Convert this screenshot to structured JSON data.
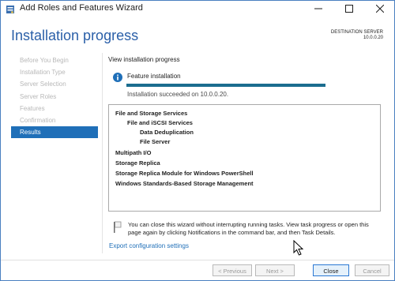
{
  "window": {
    "title": "Add Roles and Features Wizard",
    "icon": "server-manager-icon",
    "controls": [
      "minimize-icon",
      "maximize-icon",
      "close-icon"
    ]
  },
  "header": {
    "page_title": "Installation progress",
    "destination_label": "DESTINATION SERVER",
    "destination_value": "10.0.0.20"
  },
  "nav": {
    "items": [
      {
        "label": "Before You Begin",
        "active": false
      },
      {
        "label": "Installation Type",
        "active": false
      },
      {
        "label": "Server Selection",
        "active": false
      },
      {
        "label": "Server Roles",
        "active": false
      },
      {
        "label": "Features",
        "active": false
      },
      {
        "label": "Confirmation",
        "active": false
      },
      {
        "label": "Results",
        "active": true
      }
    ]
  },
  "main": {
    "view_label": "View installation progress",
    "feature_label": "Feature installation",
    "progress_fraction": 1.0,
    "success_text": "Installation succeeded on 10.0.0.20.",
    "results": [
      {
        "text": "File and Storage Services",
        "level": 0
      },
      {
        "text": "File and iSCSI Services",
        "level": 1
      },
      {
        "text": "Data Deduplication",
        "level": 2
      },
      {
        "text": "File Server",
        "level": 2
      },
      {
        "text": "Multipath I/O",
        "level": 0
      },
      {
        "text": "Storage Replica",
        "level": 0
      },
      {
        "text": "Storage Replica Module for Windows PowerShell",
        "level": 0
      },
      {
        "text": "Windows Standards-Based Storage Management",
        "level": 0
      }
    ],
    "note_text": "You can close this wizard without interrupting running tasks. View task progress or open this page again by clicking Notifications in the command bar, and then Task Details.",
    "export_link": "Export configuration settings"
  },
  "footer": {
    "previous_label": "< Previous",
    "next_label": "Next >",
    "close_label": "Close",
    "cancel_label": "Cancel"
  },
  "colors": {
    "accent": "#1f6fb8",
    "title_blue": "#2a5fa8",
    "progress": "#1b6d8f"
  }
}
